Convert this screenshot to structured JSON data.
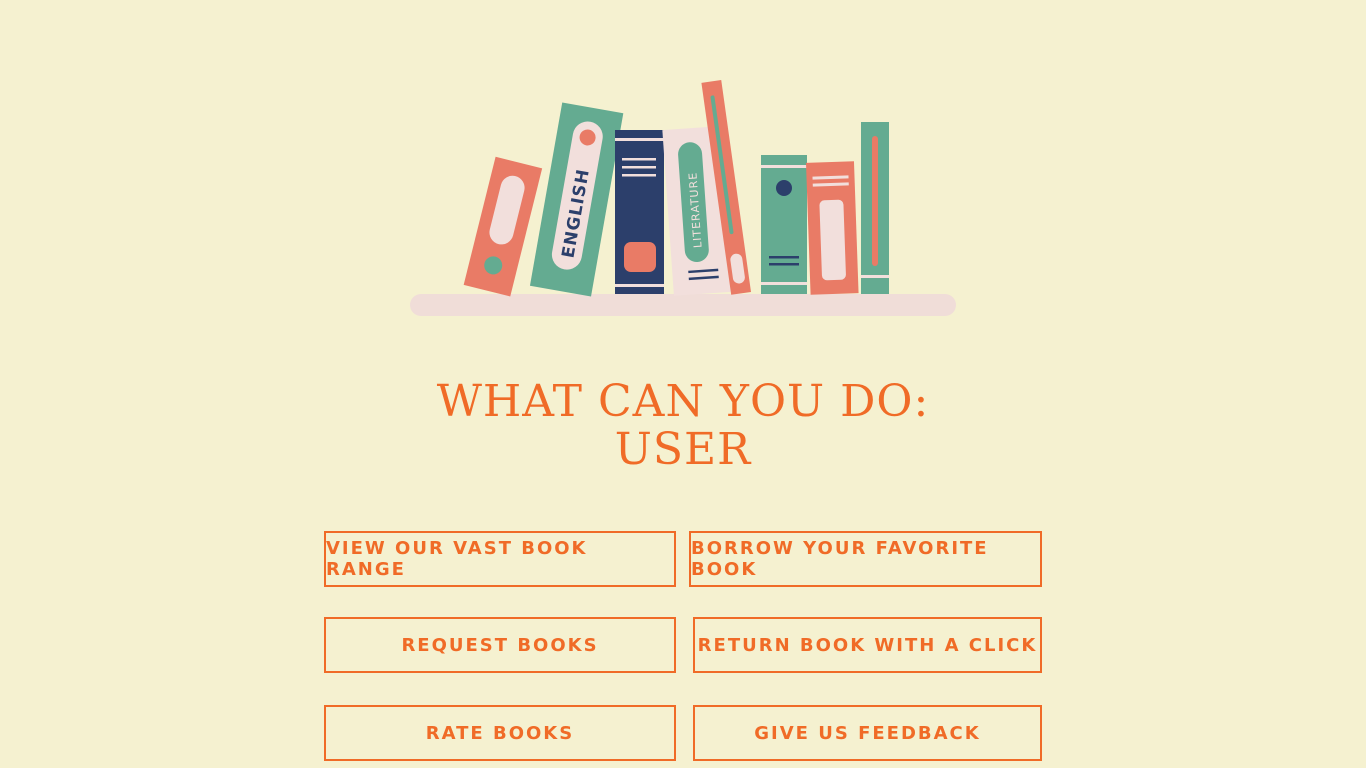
{
  "illustration": {
    "book_labels": [
      "ENGLISH",
      "LITERATURE"
    ],
    "colors": {
      "coral": "#e97b66",
      "teal": "#64ab91",
      "navy": "#2c3f6b",
      "pink": "#f2dfdc",
      "shelf": "#f0ddd8"
    }
  },
  "heading": {
    "line1": "WHAT CAN YOU DO:",
    "line2": "USER"
  },
  "actions": [
    {
      "label": "VIEW OUR VAST BOOK RANGE"
    },
    {
      "label": "BORROW YOUR FAVORITE BOOK"
    },
    {
      "label": "REQUEST BOOKS"
    },
    {
      "label": "RETURN BOOK WITH A CLICK"
    },
    {
      "label": "RATE BOOKS"
    },
    {
      "label": "GIVE US FEEDBACK"
    }
  ],
  "theme": {
    "background": "#f5f1d0",
    "accent": "#f06b27"
  }
}
